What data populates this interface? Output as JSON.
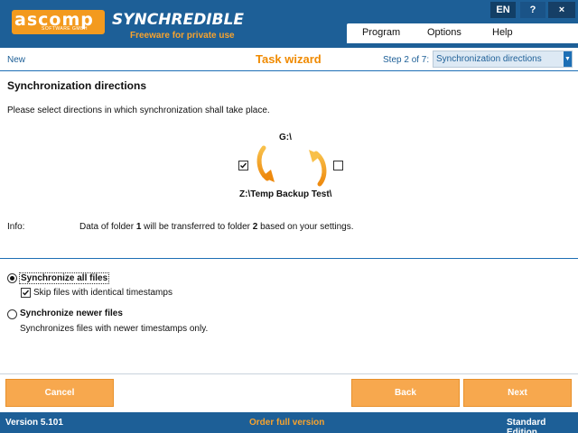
{
  "header": {
    "logo_text": "ascomp",
    "logo_subtext": "SOFTWARE GMBH",
    "app_name": "SYNCHREDIBLE",
    "tagline": "Freeware for private use",
    "window_buttons": {
      "language": "EN",
      "help": "?",
      "close": "×"
    },
    "menu": [
      {
        "label": "Program"
      },
      {
        "label": "Options"
      },
      {
        "label": "Help"
      }
    ]
  },
  "toolbar": {
    "new_label": "New",
    "title": "Task wizard",
    "step_label": "Step 2 of 7:",
    "step_selected": "Synchronization directions"
  },
  "content": {
    "title": "Synchronization directions",
    "description": "Please select directions in which synchronization shall take place.",
    "folder1": "G:\\",
    "folder2": "Z:\\Temp Backup Test\\",
    "direction_left_checked": true,
    "direction_right_checked": false,
    "info_label": "Info:",
    "info_text": "Data of folder 1 will be transferred to folder 2 based on your settings."
  },
  "options": {
    "sync_all_label": "Synchronize all files",
    "sync_all_selected": true,
    "skip_identical_label": "Skip files with identical timestamps",
    "skip_identical_checked": true,
    "sync_newer_label": "Synchronize newer files",
    "sync_newer_selected": false,
    "sync_newer_desc": "Synchronizes files with newer timestamps only."
  },
  "buttons": {
    "cancel": "Cancel",
    "back": "Back",
    "next": "Next"
  },
  "status": {
    "version": "Version 5.101",
    "order": "Order full version",
    "edition": "Standard Edition"
  },
  "colors": {
    "header_blue": "#1d5f97",
    "accent_orange": "#f39a1e",
    "button_orange": "#f7a84e"
  }
}
